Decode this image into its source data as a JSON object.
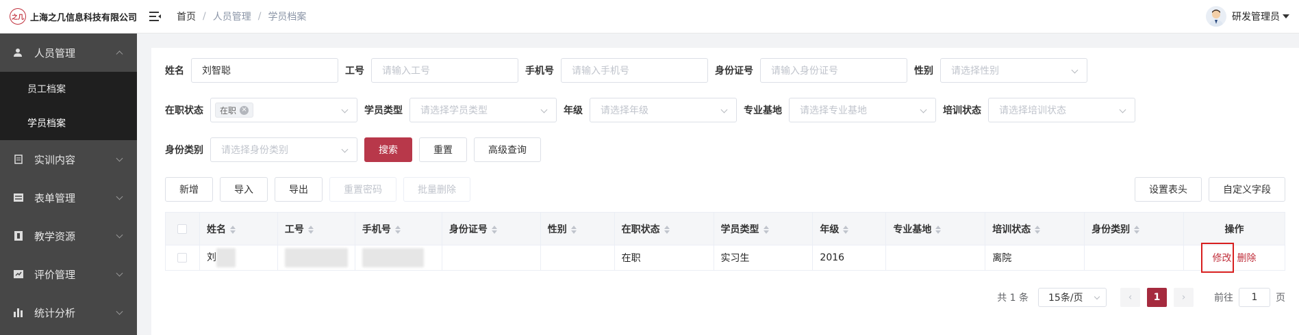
{
  "header": {
    "logo_mark": "之几",
    "company": "上海之几信息科技有限公司",
    "breadcrumb": [
      "首页",
      "人员管理",
      "学员档案"
    ],
    "user_name": "研发管理员"
  },
  "sidebar": {
    "groups": [
      {
        "label": "人员管理",
        "icon": "person-icon",
        "open": true,
        "children": [
          "员工档案",
          "学员档案"
        ]
      },
      {
        "label": "实训内容",
        "icon": "book-icon"
      },
      {
        "label": "表单管理",
        "icon": "form-icon"
      },
      {
        "label": "教学资源",
        "icon": "resource-icon"
      },
      {
        "label": "评价管理",
        "icon": "evaluate-icon"
      },
      {
        "label": "统计分析",
        "icon": "bar-chart-icon"
      }
    ]
  },
  "filters": {
    "name_label": "姓名",
    "name_value": "刘智聪",
    "job_no_label": "工号",
    "job_no_placeholder": "请输入工号",
    "phone_label": "手机号",
    "phone_placeholder": "请输入手机号",
    "id_label": "身份证号",
    "id_placeholder": "请输入身份证号",
    "gender_label": "性别",
    "gender_placeholder": "请选择性别",
    "status_label": "在职状态",
    "status_tag": "在职",
    "student_type_label": "学员类型",
    "student_type_placeholder": "请选择学员类型",
    "grade_label": "年级",
    "grade_placeholder": "请选择年级",
    "base_label": "专业基地",
    "base_placeholder": "请选择专业基地",
    "training_label": "培训状态",
    "training_placeholder": "请选择培训状态",
    "identity_label": "身份类别",
    "identity_placeholder": "请选择身份类别",
    "search_btn": "搜索",
    "reset_btn": "重置",
    "advanced_btn": "高级查询"
  },
  "toolbar": {
    "add": "新增",
    "import": "导入",
    "export": "导出",
    "reset_pwd": "重置密码",
    "batch_delete": "批量删除",
    "set_header": "设置表头",
    "custom_field": "自定义字段"
  },
  "table": {
    "headers": [
      "姓名",
      "工号",
      "手机号",
      "身份证号",
      "性别",
      "在职状态",
      "学员类型",
      "年级",
      "专业基地",
      "培训状态",
      "身份类别",
      "操作"
    ],
    "rows": [
      {
        "name": "刘",
        "job_no": "",
        "phone": "",
        "id_no": "",
        "gender": "",
        "status": "在职",
        "type": "实习生",
        "grade": "2016",
        "base": "",
        "training": "离院",
        "identity": "",
        "edit": "修改",
        "delete": "删除"
      }
    ]
  },
  "pagination": {
    "total_text": "共 1 条",
    "page_size": "15条/页",
    "current_page": "1",
    "goto_prefix": "前往",
    "goto_value": "1",
    "goto_suffix": "页"
  },
  "colors": {
    "accent": "#b8384a",
    "sidebar_bg": "#474747",
    "submenu_bg": "#1f1f1f",
    "highlight": "#d71e1e"
  }
}
